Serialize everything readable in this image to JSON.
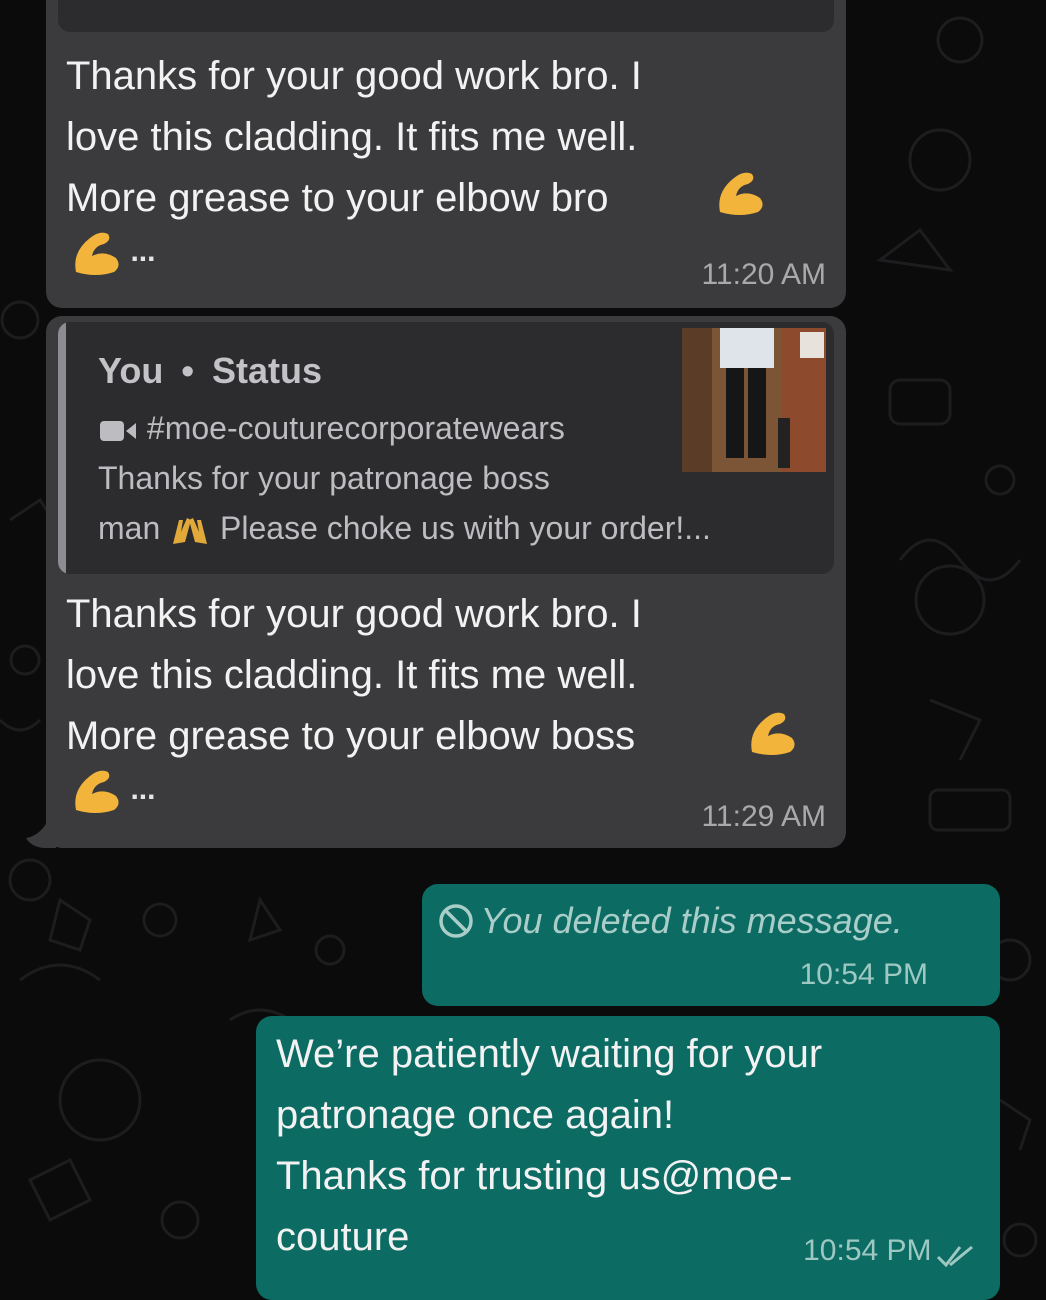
{
  "chat": {
    "messages": [
      {
        "direction": "incoming",
        "text": "Thanks for your good work bro. I\nlove this cladding. It fits me well.\nMore grease to your elbow bro",
        "ellipsis": "...",
        "time": "11:20 AM"
      },
      {
        "direction": "incoming",
        "quote": {
          "author": "You",
          "separator": "•",
          "source": "Status",
          "line1": "#moe-couturecorporatewears",
          "line2": "Thanks for your patronage boss",
          "line3_a": "man",
          "line3_b": "Please choke us with your order!..."
        },
        "text": "Thanks for your good work bro. I\nlove this cladding. It fits me well.\nMore grease to your elbow boss",
        "ellipsis": "...",
        "time": "11:29 AM"
      },
      {
        "direction": "outgoing",
        "deleted": true,
        "text": "You deleted this message.",
        "time": "10:54 PM"
      },
      {
        "direction": "outgoing",
        "text": "We’re patiently waiting for your\npatronage once again!\nThanks for trusting us@moe-\ncouture",
        "time": "10:54 PM",
        "status": "read"
      }
    ]
  },
  "icons": {
    "muscle": "flexed-biceps-emoji",
    "clap": "raising-hands-emoji",
    "video": "video-camera-icon",
    "deleted": "prohibited-icon",
    "ticks": "double-check-icon"
  },
  "colors": {
    "background": "#0b0b0b",
    "incoming_bubble": "#3b3b3d",
    "outgoing_bubble": "#0c6b63",
    "quote_bg": "#2c2c2e"
  }
}
